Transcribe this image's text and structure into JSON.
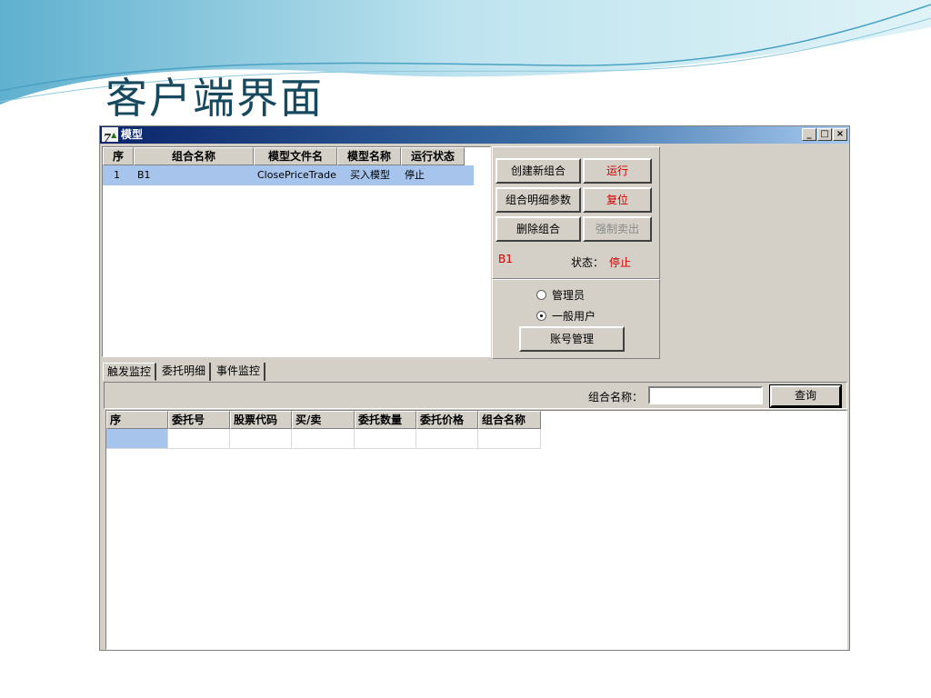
{
  "slide": {
    "title": "客户端界面"
  },
  "window": {
    "title": "模型",
    "controls": {
      "minimize": "_",
      "maximize": "□",
      "close": "×"
    }
  },
  "model_table": {
    "columns": [
      "序",
      "组合名称",
      "模型文件名",
      "模型名称",
      "运行状态"
    ],
    "rows": [
      [
        "1",
        "B1",
        "ClosePriceTrade",
        "买入模型",
        "停止"
      ]
    ]
  },
  "controls": {
    "create_combo": "创建新组合",
    "run": "运行",
    "combo_params": "组合明细参数",
    "reset": "复位",
    "delete_combo": "删除组合",
    "force_sell": "强制卖出",
    "selected_combo": "B1",
    "status_label": "状态：",
    "status_value": "停止"
  },
  "user_type": {
    "options": [
      "管理员",
      "一般用户"
    ],
    "selected": "一般用户",
    "account_mgmt": "账号管理"
  },
  "tabs": [
    "触发监控",
    "委托明细",
    "事件监控"
  ],
  "search": {
    "label": "组合名称：",
    "value": "",
    "query_button": "查询"
  },
  "order_table": {
    "columns": [
      "序",
      "委托号",
      "股票代码",
      "买/卖",
      "委托数量",
      "委托价格",
      "组合名称"
    ],
    "rows": []
  },
  "colors": {
    "selected_row": "#a6c4ec",
    "alert_red": "#d00000",
    "title_blue": "#16485e"
  }
}
